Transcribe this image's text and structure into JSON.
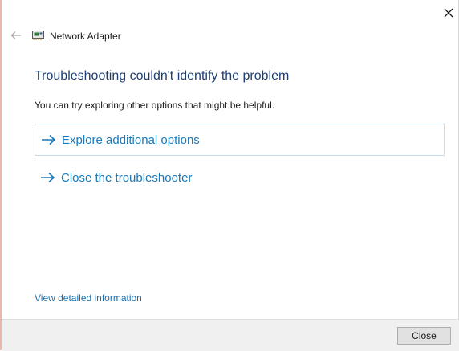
{
  "window": {
    "close_icon": "close-icon"
  },
  "header": {
    "back_icon": "back-arrow-icon",
    "adapter_icon": "network-adapter-icon",
    "title": "Network Adapter"
  },
  "main": {
    "heading": "Troubleshooting couldn't identify the problem",
    "subtext": "You can try exploring other options that might be helpful.",
    "options": [
      {
        "label": "Explore additional options",
        "icon": "arrow-right-icon",
        "selected": true
      },
      {
        "label": "Close the troubleshooter",
        "icon": "arrow-right-icon",
        "selected": false
      }
    ],
    "detail_link": "View detailed information"
  },
  "footer": {
    "close_button": "Close"
  },
  "colors": {
    "heading": "#1e3f75",
    "link": "#1b7ab9",
    "selected_border": "#c6dbee",
    "footer_bg": "#f0f0f0"
  }
}
